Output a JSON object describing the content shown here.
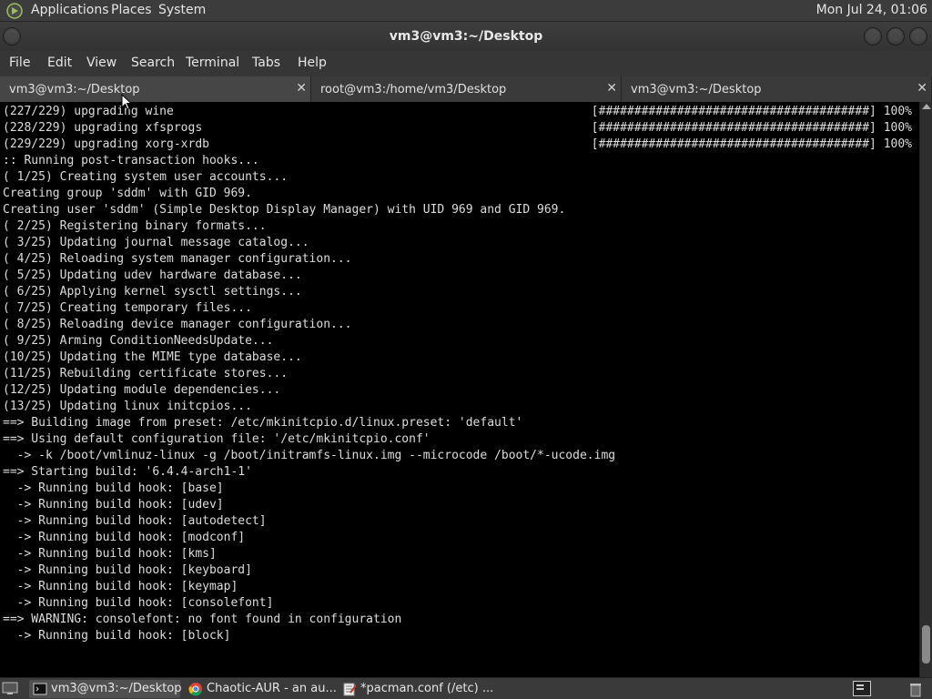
{
  "top_panel": {
    "menus": [
      "Applications",
      "Places",
      "System"
    ],
    "clock": "Mon Jul 24, 01:06"
  },
  "window": {
    "title": "vm3@vm3:~/Desktop"
  },
  "menubar": [
    "File",
    "Edit",
    "View",
    "Search",
    "Terminal",
    "Tabs",
    "Help"
  ],
  "tabs": [
    {
      "label": "vm3@vm3:~/Desktop",
      "active": true
    },
    {
      "label": "root@vm3:/home/vm3/Desktop",
      "active": false
    },
    {
      "label": "vm3@vm3:~/Desktop",
      "active": false
    }
  ],
  "terminal": {
    "lines": [
      "(227/229) upgrading wine",
      "(228/229) upgrading xfsprogs",
      "(229/229) upgrading xorg-xrdb",
      ":: Running post-transaction hooks...",
      "( 1/25) Creating system user accounts...",
      "Creating group 'sddm' with GID 969.",
      "Creating user 'sddm' (Simple Desktop Display Manager) with UID 969 and GID 969.",
      "( 2/25) Registering binary formats...",
      "( 3/25) Updating journal message catalog...",
      "( 4/25) Reloading system manager configuration...",
      "( 5/25) Updating udev hardware database...",
      "( 6/25) Applying kernel sysctl settings...",
      "( 7/25) Creating temporary files...",
      "( 8/25) Reloading device manager configuration...",
      "( 9/25) Arming ConditionNeedsUpdate...",
      "(10/25) Updating the MIME type database...",
      "(11/25) Rebuilding certificate stores...",
      "(12/25) Updating module dependencies...",
      "(13/25) Updating linux initcpios...",
      "==> Building image from preset: /etc/mkinitcpio.d/linux.preset: 'default'",
      "==> Using default configuration file: '/etc/mkinitcpio.conf'",
      "  -> -k /boot/vmlinuz-linux -g /boot/initramfs-linux.img --microcode /boot/*-ucode.img",
      "==> Starting build: '6.4.4-arch1-1'",
      "  -> Running build hook: [base]",
      "  -> Running build hook: [udev]",
      "  -> Running build hook: [autodetect]",
      "  -> Running build hook: [modconf]",
      "  -> Running build hook: [kms]",
      "  -> Running build hook: [keyboard]",
      "  -> Running build hook: [keymap]",
      "  -> Running build hook: [consolefont]",
      "==> WARNING: consolefont: no font found in configuration",
      "  -> Running build hook: [block]"
    ],
    "progress": [
      "[######################################] 100%",
      "[######################################] 100%",
      "[######################################] 100%"
    ]
  },
  "taskbar": {
    "tasks": [
      {
        "label": "vm3@vm3:~/Desktop",
        "icon": "terminal-icon",
        "active": true
      },
      {
        "label": "Chaotic-AUR - an au...",
        "icon": "chrome-icon",
        "active": false
      },
      {
        "label": "*pacman.conf (/etc) ...",
        "icon": "text-editor-icon",
        "active": false
      }
    ]
  },
  "colors": {
    "terminal_bg": "#000000",
    "terminal_fg": "#dcdcdc",
    "panel_bg": "#3c3c3c"
  }
}
